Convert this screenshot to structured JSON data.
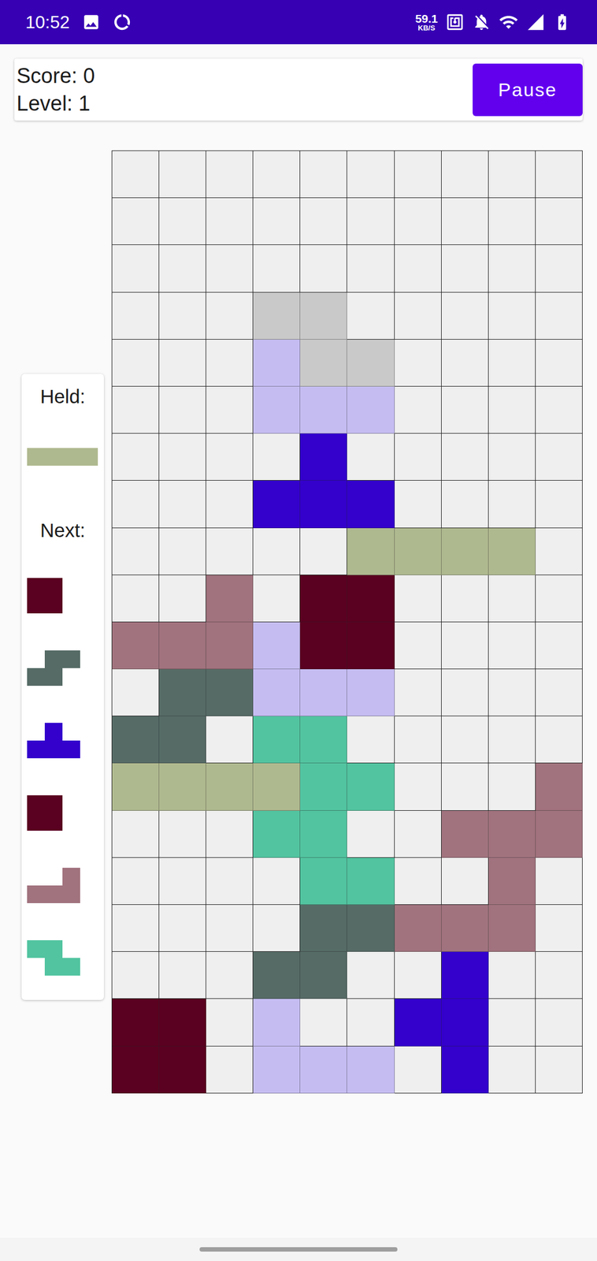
{
  "status_bar": {
    "time": "10:52",
    "speed": "59.1",
    "speed_unit": "KB/S"
  },
  "header": {
    "score": "Score: 0",
    "level": "Level: 1",
    "pause_button": "Pause"
  },
  "palette": {
    "G": "#c9c9c9",
    "L": "#c5bdf2",
    "B": "#3300cc",
    "O": "#afb98f",
    "M": "#a1737e",
    "R": "#5a0020",
    "S": "#566b66",
    "T": "#52c4a0"
  },
  "side_panel": {
    "held_label": "Held:",
    "held": {
      "shape": [
        "OOOO"
      ]
    },
    "next_label": "Next:",
    "next": [
      {
        "shape": [
          "RR",
          "RR"
        ]
      },
      {
        "shape": [
          ".SS",
          "SS."
        ]
      },
      {
        "shape": [
          ".B.",
          "BBB"
        ]
      },
      {
        "shape": [
          "RR",
          "RR"
        ]
      },
      {
        "shape": [
          "..M",
          "MMM"
        ]
      },
      {
        "shape": [
          "TT.",
          ".TT"
        ]
      }
    ]
  },
  "board": {
    "rows": [
      "..........",
      "..........",
      "..........",
      "...GG.....",
      "...LGG....",
      "...LLL....",
      "....B.....",
      "...BBB....",
      ".....OOOO.",
      "..M.RR....",
      "MMMLRR....",
      ".SSLLL....",
      "SS.TT.....",
      "OOOOTT...M",
      "...TT..MMM",
      "....TT..M.",
      "....SSMMM.",
      "...SS..B..",
      "RR.L..BB..",
      "RR.LLL.B.."
    ]
  }
}
